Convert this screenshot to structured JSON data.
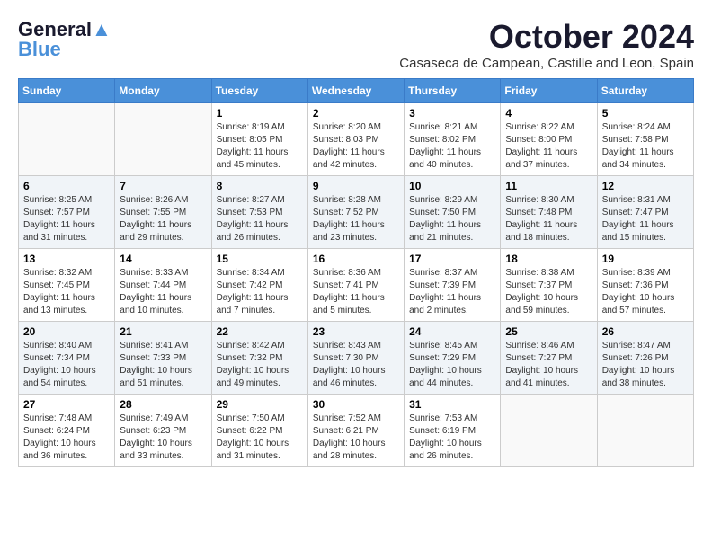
{
  "header": {
    "logo_line1": "General",
    "logo_line2": "Blue",
    "month": "October 2024",
    "location": "Casaseca de Campean, Castille and Leon, Spain"
  },
  "weekdays": [
    "Sunday",
    "Monday",
    "Tuesday",
    "Wednesday",
    "Thursday",
    "Friday",
    "Saturday"
  ],
  "weeks": [
    [
      {
        "day": "",
        "info": ""
      },
      {
        "day": "",
        "info": ""
      },
      {
        "day": "1",
        "info": "Sunrise: 8:19 AM\nSunset: 8:05 PM\nDaylight: 11 hours and 45 minutes."
      },
      {
        "day": "2",
        "info": "Sunrise: 8:20 AM\nSunset: 8:03 PM\nDaylight: 11 hours and 42 minutes."
      },
      {
        "day": "3",
        "info": "Sunrise: 8:21 AM\nSunset: 8:02 PM\nDaylight: 11 hours and 40 minutes."
      },
      {
        "day": "4",
        "info": "Sunrise: 8:22 AM\nSunset: 8:00 PM\nDaylight: 11 hours and 37 minutes."
      },
      {
        "day": "5",
        "info": "Sunrise: 8:24 AM\nSunset: 7:58 PM\nDaylight: 11 hours and 34 minutes."
      }
    ],
    [
      {
        "day": "6",
        "info": "Sunrise: 8:25 AM\nSunset: 7:57 PM\nDaylight: 11 hours and 31 minutes."
      },
      {
        "day": "7",
        "info": "Sunrise: 8:26 AM\nSunset: 7:55 PM\nDaylight: 11 hours and 29 minutes."
      },
      {
        "day": "8",
        "info": "Sunrise: 8:27 AM\nSunset: 7:53 PM\nDaylight: 11 hours and 26 minutes."
      },
      {
        "day": "9",
        "info": "Sunrise: 8:28 AM\nSunset: 7:52 PM\nDaylight: 11 hours and 23 minutes."
      },
      {
        "day": "10",
        "info": "Sunrise: 8:29 AM\nSunset: 7:50 PM\nDaylight: 11 hours and 21 minutes."
      },
      {
        "day": "11",
        "info": "Sunrise: 8:30 AM\nSunset: 7:48 PM\nDaylight: 11 hours and 18 minutes."
      },
      {
        "day": "12",
        "info": "Sunrise: 8:31 AM\nSunset: 7:47 PM\nDaylight: 11 hours and 15 minutes."
      }
    ],
    [
      {
        "day": "13",
        "info": "Sunrise: 8:32 AM\nSunset: 7:45 PM\nDaylight: 11 hours and 13 minutes."
      },
      {
        "day": "14",
        "info": "Sunrise: 8:33 AM\nSunset: 7:44 PM\nDaylight: 11 hours and 10 minutes."
      },
      {
        "day": "15",
        "info": "Sunrise: 8:34 AM\nSunset: 7:42 PM\nDaylight: 11 hours and 7 minutes."
      },
      {
        "day": "16",
        "info": "Sunrise: 8:36 AM\nSunset: 7:41 PM\nDaylight: 11 hours and 5 minutes."
      },
      {
        "day": "17",
        "info": "Sunrise: 8:37 AM\nSunset: 7:39 PM\nDaylight: 11 hours and 2 minutes."
      },
      {
        "day": "18",
        "info": "Sunrise: 8:38 AM\nSunset: 7:37 PM\nDaylight: 10 hours and 59 minutes."
      },
      {
        "day": "19",
        "info": "Sunrise: 8:39 AM\nSunset: 7:36 PM\nDaylight: 10 hours and 57 minutes."
      }
    ],
    [
      {
        "day": "20",
        "info": "Sunrise: 8:40 AM\nSunset: 7:34 PM\nDaylight: 10 hours and 54 minutes."
      },
      {
        "day": "21",
        "info": "Sunrise: 8:41 AM\nSunset: 7:33 PM\nDaylight: 10 hours and 51 minutes."
      },
      {
        "day": "22",
        "info": "Sunrise: 8:42 AM\nSunset: 7:32 PM\nDaylight: 10 hours and 49 minutes."
      },
      {
        "day": "23",
        "info": "Sunrise: 8:43 AM\nSunset: 7:30 PM\nDaylight: 10 hours and 46 minutes."
      },
      {
        "day": "24",
        "info": "Sunrise: 8:45 AM\nSunset: 7:29 PM\nDaylight: 10 hours and 44 minutes."
      },
      {
        "day": "25",
        "info": "Sunrise: 8:46 AM\nSunset: 7:27 PM\nDaylight: 10 hours and 41 minutes."
      },
      {
        "day": "26",
        "info": "Sunrise: 8:47 AM\nSunset: 7:26 PM\nDaylight: 10 hours and 38 minutes."
      }
    ],
    [
      {
        "day": "27",
        "info": "Sunrise: 7:48 AM\nSunset: 6:24 PM\nDaylight: 10 hours and 36 minutes."
      },
      {
        "day": "28",
        "info": "Sunrise: 7:49 AM\nSunset: 6:23 PM\nDaylight: 10 hours and 33 minutes."
      },
      {
        "day": "29",
        "info": "Sunrise: 7:50 AM\nSunset: 6:22 PM\nDaylight: 10 hours and 31 minutes."
      },
      {
        "day": "30",
        "info": "Sunrise: 7:52 AM\nSunset: 6:21 PM\nDaylight: 10 hours and 28 minutes."
      },
      {
        "day": "31",
        "info": "Sunrise: 7:53 AM\nSunset: 6:19 PM\nDaylight: 10 hours and 26 minutes."
      },
      {
        "day": "",
        "info": ""
      },
      {
        "day": "",
        "info": ""
      }
    ]
  ]
}
